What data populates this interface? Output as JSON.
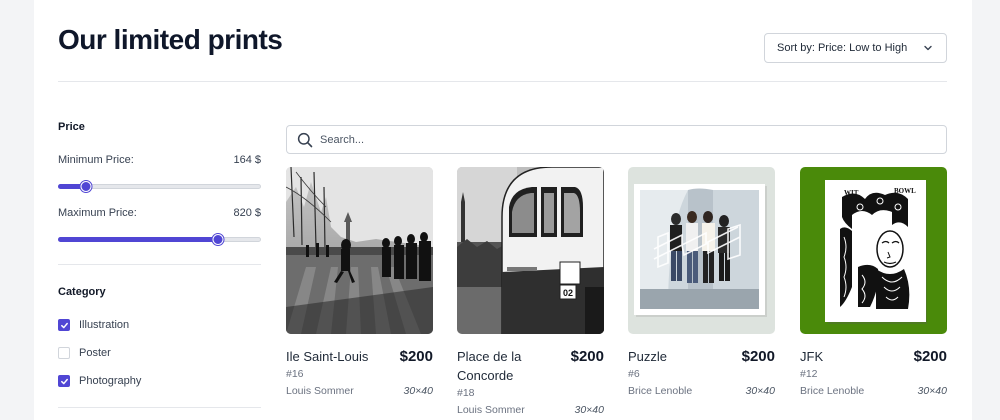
{
  "header": {
    "title": "Our limited prints",
    "sort_label": "Sort by: Price: Low to High"
  },
  "filters": {
    "price": {
      "title": "Price",
      "min_label": "Minimum Price:",
      "min_value": "164 $",
      "min_fraction": 0.14,
      "max_label": "Maximum Price:",
      "max_value": "820 $",
      "max_fraction": 0.79
    },
    "category": {
      "title": "Category",
      "items": [
        {
          "label": "Illustration",
          "checked": true
        },
        {
          "label": "Poster",
          "checked": false
        },
        {
          "label": "Photography",
          "checked": true
        }
      ]
    }
  },
  "search": {
    "placeholder": "Search..."
  },
  "colors": {
    "accent": "#5046d4"
  },
  "products": [
    {
      "name": "Ile Saint-Louis",
      "price": "$200",
      "number": "#16",
      "artist": "Louis Sommer",
      "size": "30×40"
    },
    {
      "name": "Place de la Concorde",
      "price": "$200",
      "number": "#18",
      "artist": "Louis Sommer",
      "size": "30×40"
    },
    {
      "name": "Puzzle",
      "price": "$200",
      "number": "#6",
      "artist": "Brice Lenoble",
      "size": "30×40"
    },
    {
      "name": "JFK",
      "price": "$200",
      "number": "#12",
      "artist": "Brice Lenoble",
      "size": "30×40"
    }
  ]
}
